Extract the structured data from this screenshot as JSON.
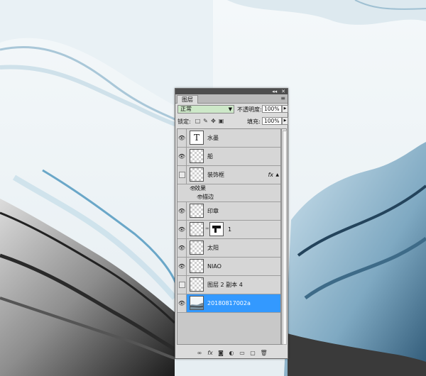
{
  "panel": {
    "collapse_label": "◂◂",
    "close_label": "✕",
    "tab_label": "图层",
    "menu_icon": "≡"
  },
  "controls": {
    "blend_mode": "正常",
    "opacity_label": "不透明度:",
    "opacity_value": "100%",
    "lock_label": "锁定:",
    "fill_label": "填充:",
    "fill_value": "100%"
  },
  "layers": [
    {
      "name": "水墨",
      "visible": true,
      "thumb": "text-T"
    },
    {
      "name": "船",
      "visible": true,
      "thumb": "transparent"
    },
    {
      "name": "装饰框",
      "visible": false,
      "thumb": "transparent",
      "fx": "fx",
      "effects_label": "效果",
      "effect": "描边"
    },
    {
      "name": "印章",
      "visible": true,
      "thumb": "transparent"
    },
    {
      "name": "1",
      "visible": true,
      "thumb": "transparent",
      "mask": true
    },
    {
      "name": "太阳",
      "visible": true,
      "thumb": "transparent"
    },
    {
      "name": "NIAO",
      "visible": true,
      "thumb": "transparent"
    },
    {
      "name": "图层 2 副本 4",
      "visible": false,
      "thumb": "transparent"
    },
    {
      "name": "20180817002a",
      "visible": true,
      "thumb": "image",
      "selected": true
    }
  ],
  "colors": {
    "selected_row": "#3399ff",
    "blend_field": "#cde8c8",
    "panel_bg": "#dcdcdc"
  },
  "bottom_icons": [
    "link-icon",
    "fx-icon",
    "mask-icon",
    "adjustment-icon",
    "folder-icon",
    "new-layer-icon",
    "trash-icon"
  ]
}
